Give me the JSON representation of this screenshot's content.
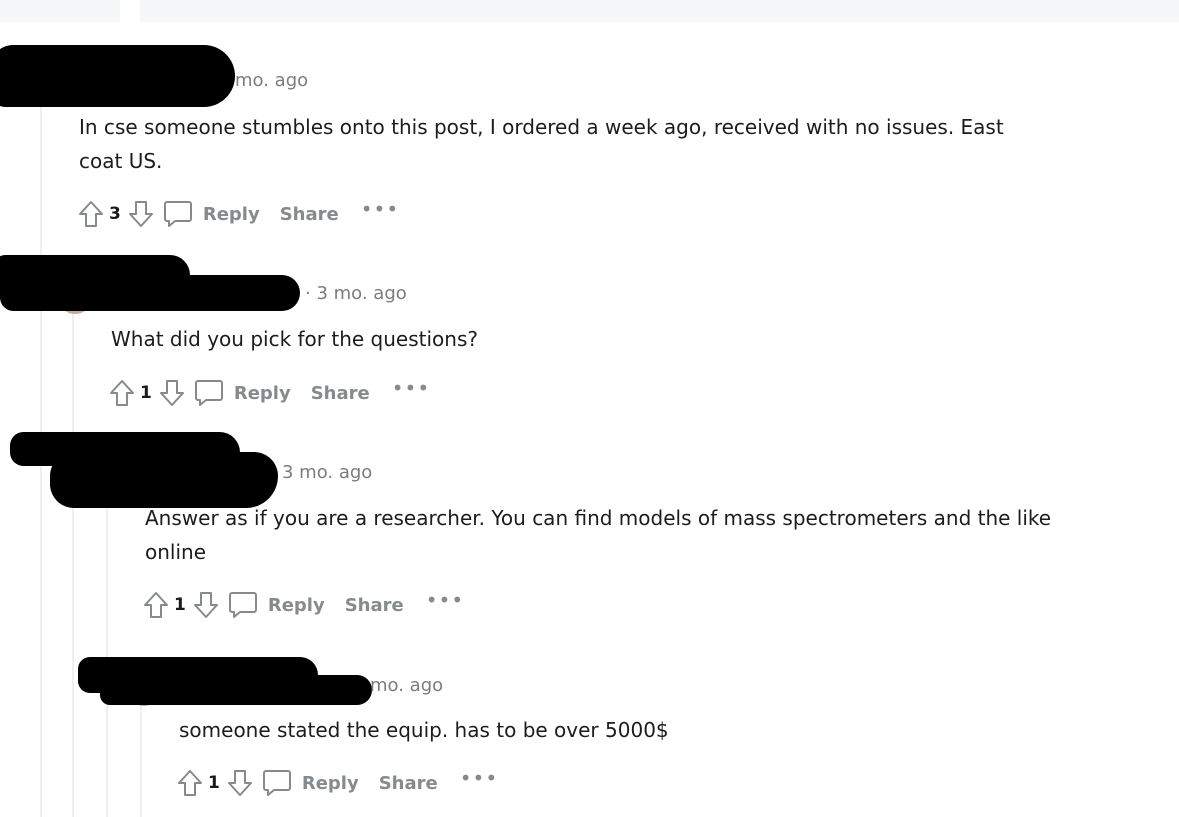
{
  "comments": [
    {
      "time": "mo. ago",
      "text_line1": "In c",
      "text_line1_rest": "se someone stumbles onto this post, I ordered a week ago, received with no issues. East",
      "text_line2": "coa",
      "text_line2_rest": "t US.",
      "votes": "3",
      "reply_label": "Reply",
      "share_label": "Share",
      "more_label": "•••"
    },
    {
      "time": "· 3 mo. ago",
      "text_line1": "What did you pick for the questions?",
      "votes": "1",
      "reply_label": "Reply",
      "share_label": "Share",
      "more_label": "•••"
    },
    {
      "time": "3 mo. ago",
      "text_line1": "Answer as if you are a researcher. You can find models of mass spectrometers and the like",
      "text_line2": "online",
      "votes": "1",
      "reply_label": "Reply",
      "share_label": "Share",
      "more_label": "•••"
    },
    {
      "time": "mo. ago",
      "text_line1": "someone stated the equip. has to be over 5000$",
      "votes": "1",
      "reply_label": "Reply",
      "share_label": "Share",
      "more_label": "•••"
    }
  ],
  "icons": {
    "upvote": "upvote-arrow-icon",
    "downvote": "downvote-arrow-icon",
    "reply": "speech-bubble-icon",
    "more": "ellipsis-icon"
  },
  "colors": {
    "muted": "#878a8c",
    "thread_line": "#edeff1",
    "redaction": "#000000"
  }
}
